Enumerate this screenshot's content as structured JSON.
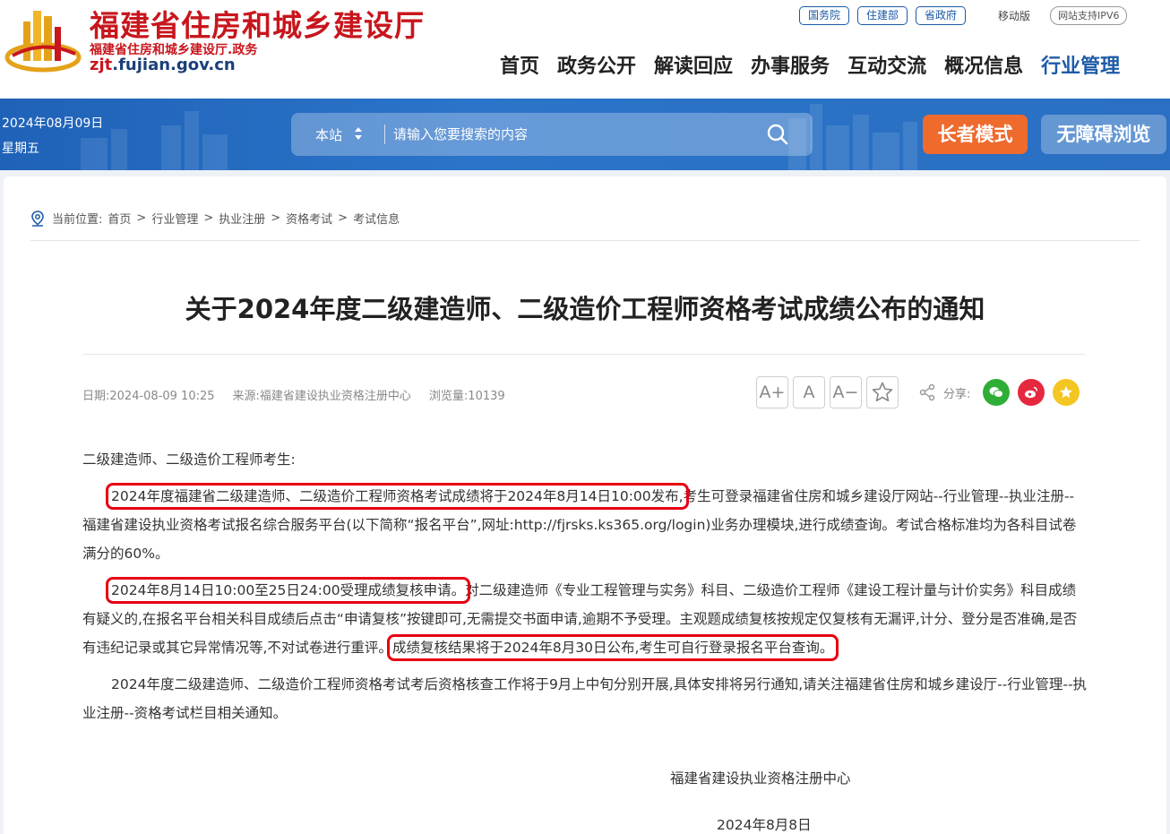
{
  "header": {
    "title": "福建省住房和城乡建设厅",
    "subtitle": "福建省住房和城乡建设厅.政务",
    "domain_main": "zjt",
    "domain_rest": ".fujian.gov.cn",
    "links": [
      "国务院",
      "住建部",
      "省政府"
    ],
    "mobile": "移动版",
    "ipv6": "网站支持IPV6",
    "nav": [
      "首页",
      "政务公开",
      "解读回应",
      "办事服务",
      "互动交流",
      "概况信息",
      "行业管理"
    ],
    "active_nav": "行业管理"
  },
  "banner": {
    "date": "2024年08月09日",
    "weekday": "星期五",
    "search_scope": "本站",
    "search_placeholder": "请输入您要搜索的内容",
    "elder_mode": "长者模式",
    "accessibility": "无障碍浏览"
  },
  "breadcrumb": {
    "prefix": "当前位置:",
    "items": [
      "首页",
      "行业管理",
      "执业注册",
      "资格考试",
      "考试信息"
    ]
  },
  "article": {
    "title": "关于2024年度二级建造师、二级造价工程师资格考试成绩公布的通知",
    "meta_date": "日期:2024-08-09 10:25",
    "meta_source": "来源:福建省建设执业资格注册中心",
    "meta_views": "浏览量:10139",
    "font_larger": "A+",
    "font_normal": "A",
    "font_smaller": "A−",
    "share_label": "分享:",
    "salutation": "二级建造师、二级造价工程师考生:",
    "p1_hl": "2024年度福建省二级建造师、二级造价工程师资格考试成绩将于2024年8月14日10:00发布,",
    "p1_rest": "考生可登录福建省住房和城乡建设厅网站--行业管理--执业注册--福建省建设执业资格考试报名综合服务平台(以下简称“报名平台”,网址:http://fjrsks.ks365.org/login)业务办理模块,进行成绩查询。考试合格标准均为各科目试卷满分的60%。",
    "p2_hl": "2024年8月14日10:00至25日24:00受理成绩复核申请。",
    "p2_mid": "对二级建造师《专业工程管理与实务》科目、二级造价工程师《建设工程计量与计价实务》科目成绩有疑义的,在报名平台相关科目成绩后点击“申请复核”按键即可,无需提交书面申请,逾期不予受理。主观题成绩复核按规定仅复核有无漏评,计分、登分是否准确,是否有违纪记录或其它异常情况等,不对试卷进行重评。",
    "p2_hl2": "成绩复核结果将于2024年8月30日公布,考生可自行登录报名平台查询。",
    "p3": "2024年度二级建造师、二级造价工程师资格考试考后资格核查工作将于9月上中旬分别开展,具体安排将另行通知,请关注福建省住房和城乡建设厅--行业管理--执业注册--资格考试栏目相关通知。",
    "signature": "福建省建设执业资格注册中心",
    "sign_date": "2024年8月8日"
  },
  "colors": {
    "brand_red": "#c8161d",
    "nav_blue": "#1d5ba8",
    "banner_blue": "#2a6fc2",
    "elder_orange": "#ee6a2d",
    "highlight_red": "#e60012"
  }
}
